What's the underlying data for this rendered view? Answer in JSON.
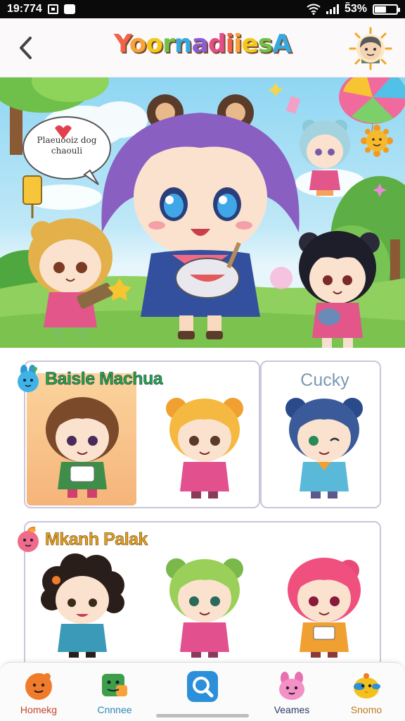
{
  "status_bar": {
    "time": "19:774",
    "battery": "5̃3%",
    "battery_level": 0.53
  },
  "header": {
    "title": "YoornadiiesA",
    "title_colors": [
      "#f2644a",
      "#f7a23a",
      "#f4c81a",
      "#6cc24a",
      "#36a9e1",
      "#8a5cd6",
      "#e54d8a"
    ]
  },
  "hero": {
    "speech_bubble": "Plaeuooiz dog\nchaouli"
  },
  "sections": [
    {
      "title": "Baisle Machua",
      "subtitle": "Cucky",
      "title_color": "#27a346",
      "characters": [
        "brown-hair-chibi",
        "blonde-bear-chibi",
        "blue-bear-chibi"
      ]
    },
    {
      "title": "Mkanh Palak",
      "title_color": "#e0a21b",
      "characters": [
        "curly-hair-chibi",
        "green-bear-chibi",
        "pink-hair-chibi"
      ]
    }
  ],
  "bottom_nav": [
    {
      "label": "Homekg",
      "icon": "orange-face-icon",
      "color": "#f07b2b"
    },
    {
      "label": "Cnnnee",
      "icon": "green-block-icon",
      "color": "#3e9e4a"
    },
    {
      "label": "",
      "icon": "search-icon",
      "color": "#2b8fd9"
    },
    {
      "label": "Veames",
      "icon": "pink-bunny-icon",
      "color": "#e86fb0"
    },
    {
      "label": "Snomo",
      "icon": "yellow-chick-icon",
      "color": "#f2c21a"
    }
  ],
  "colors": {
    "accent": "#2b8fd9",
    "card_border": "#c9c6dc",
    "highlight_tile": "#f7c389"
  }
}
